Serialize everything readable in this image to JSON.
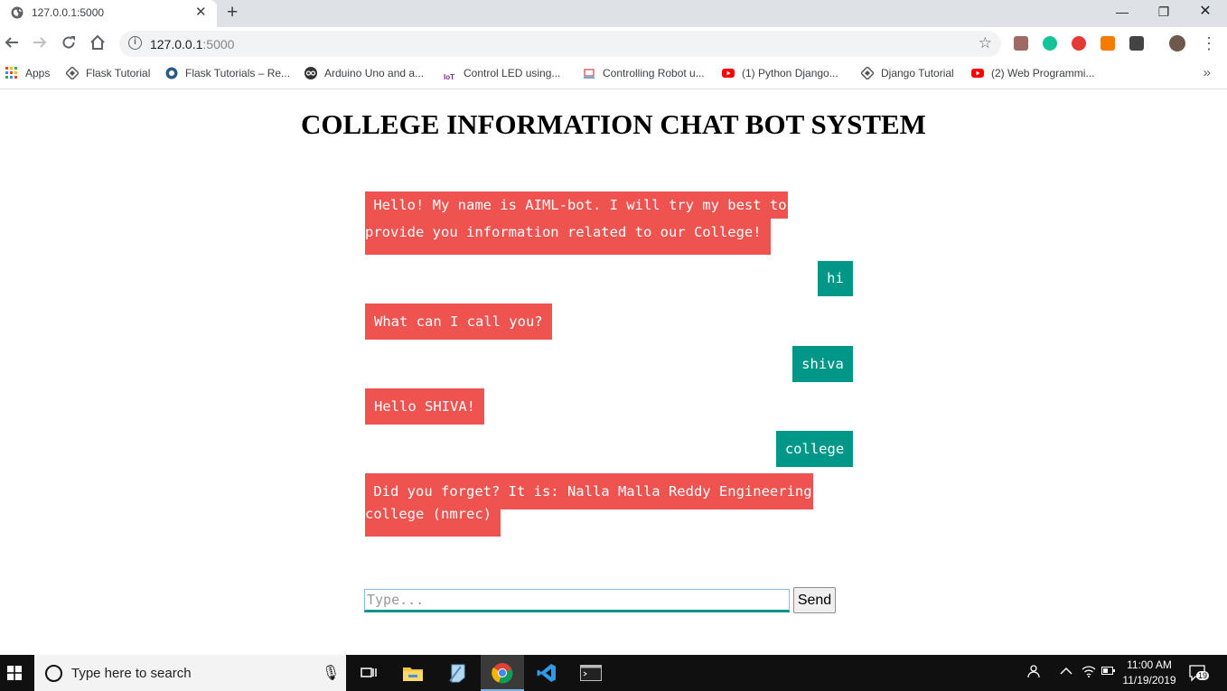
{
  "browser": {
    "tab_title": "127.0.0.1:5000",
    "tab_close": "✕",
    "new_tab": "+",
    "window_controls": {
      "minimize": "—",
      "restore": "❐",
      "close": "✕"
    },
    "url_host": "127.0.0.1",
    "url_port": ":5000",
    "bookmarks": [
      {
        "label": "Apps",
        "icon": "apps-grid-icon"
      },
      {
        "label": "Flask Tutorial",
        "icon": "diamond-icon"
      },
      {
        "label": "Flask Tutorials – Re...",
        "icon": "python-icon"
      },
      {
        "label": "Arduino Uno and a...",
        "icon": "infinity-icon"
      },
      {
        "label": "Control LED using...",
        "icon": "iot-icon"
      },
      {
        "label": "Controlling Robot u...",
        "icon": "robot-icon"
      },
      {
        "label": "(1) Python Django...",
        "icon": "youtube-icon"
      },
      {
        "label": "Django Tutorial",
        "icon": "diamond-icon"
      },
      {
        "label": "(2) Web Programmi...",
        "icon": "youtube-icon"
      }
    ],
    "bookmarks_more": "»"
  },
  "page": {
    "title": "COLLEGE INFORMATION CHAT BOT SYSTEM",
    "messages": [
      {
        "from": "bot",
        "line1": " Hello! My name is AIML-bot. I will try my best to",
        "line2": "provide you information related to our College! "
      },
      {
        "from": "user",
        "text": "hi"
      },
      {
        "from": "bot",
        "text": "What can I call you?"
      },
      {
        "from": "user",
        "text": "shiva"
      },
      {
        "from": "bot",
        "text": "Hello SHIVA!"
      },
      {
        "from": "user",
        "text": "college"
      },
      {
        "from": "bot",
        "line1": " Did you forget? It is: Nalla Malla Reddy Engineering",
        "line2": "college (nmrec) "
      }
    ],
    "input_placeholder": "Type...",
    "input_value": "",
    "send_label": "Send",
    "colors": {
      "bot_bubble": "#ef5350",
      "user_bubble": "#009688"
    }
  },
  "taskbar": {
    "search_placeholder": "Type here to search",
    "time": "11:00 AM",
    "date": "11/19/2019",
    "notifications": "19"
  }
}
